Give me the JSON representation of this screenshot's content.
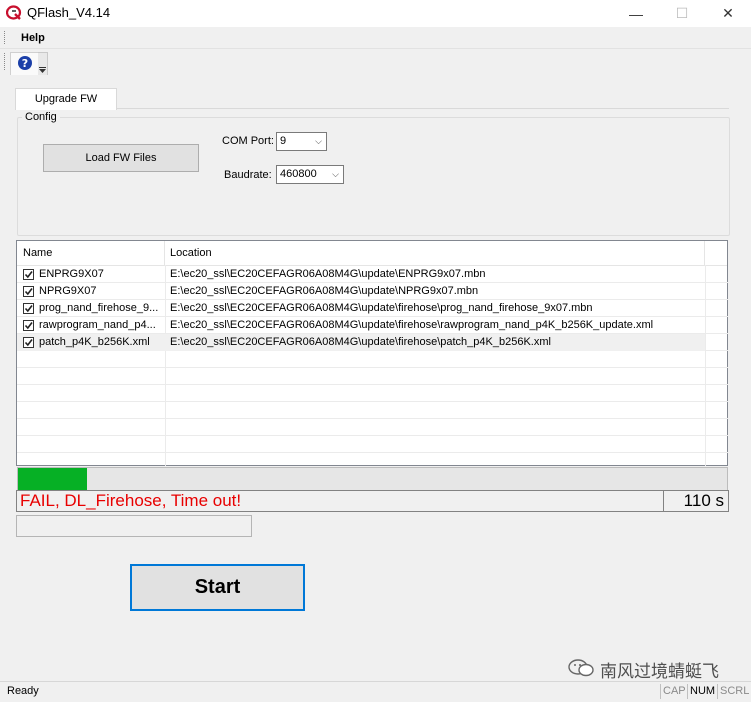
{
  "window": {
    "title": "QFlash_V4.14",
    "controls": {
      "minimize": "—",
      "maximize": "☐",
      "close": "✕"
    }
  },
  "menu": {
    "items": [
      "Help"
    ]
  },
  "toolbar": {
    "help_icon": "help-icon"
  },
  "tabs": [
    {
      "label": "Upgrade FW",
      "active": true
    }
  ],
  "config": {
    "group_label": "Config",
    "load_button": "Load FW Files",
    "com_port_label": "COM Port:",
    "com_port_value": "9",
    "baudrate_label": "Baudrate:",
    "baudrate_value": "460800"
  },
  "file_list": {
    "columns": [
      "Name",
      "Location"
    ],
    "rows": [
      {
        "checked": true,
        "name": "ENPRG9X07",
        "location": "E:\\ec20_ssl\\EC20CEFAGR06A08M4G\\update\\ENPRG9x07.mbn"
      },
      {
        "checked": true,
        "name": "NPRG9X07",
        "location": "E:\\ec20_ssl\\EC20CEFAGR06A08M4G\\update\\NPRG9x07.mbn"
      },
      {
        "checked": true,
        "name": "prog_nand_firehose_9...",
        "location": "E:\\ec20_ssl\\EC20CEFAGR06A08M4G\\update\\firehose\\prog_nand_firehose_9x07.mbn"
      },
      {
        "checked": true,
        "name": "rawprogram_nand_p4...",
        "location": "E:\\ec20_ssl\\EC20CEFAGR06A08M4G\\update\\firehose\\rawprogram_nand_p4K_b256K_update.xml"
      },
      {
        "checked": true,
        "name": "patch_p4K_b256K.xml",
        "location": "E:\\ec20_ssl\\EC20CEFAGR06A08M4G\\update\\firehose\\patch_p4K_b256K.xml"
      }
    ]
  },
  "progress": {
    "fraction": 0.097,
    "color": "#06b025"
  },
  "status": {
    "message": "FAIL, DL_Firehose, Time out!",
    "message_color": "#e80000",
    "elapsed": "110 s"
  },
  "start_button": "Start",
  "watermark": "南风过境蜻蜓飞",
  "statusbar": {
    "text": "Ready",
    "indicators": [
      {
        "label": "CAP",
        "active": false
      },
      {
        "label": "NUM",
        "active": true
      },
      {
        "label": "SCRL",
        "active": false
      }
    ]
  }
}
